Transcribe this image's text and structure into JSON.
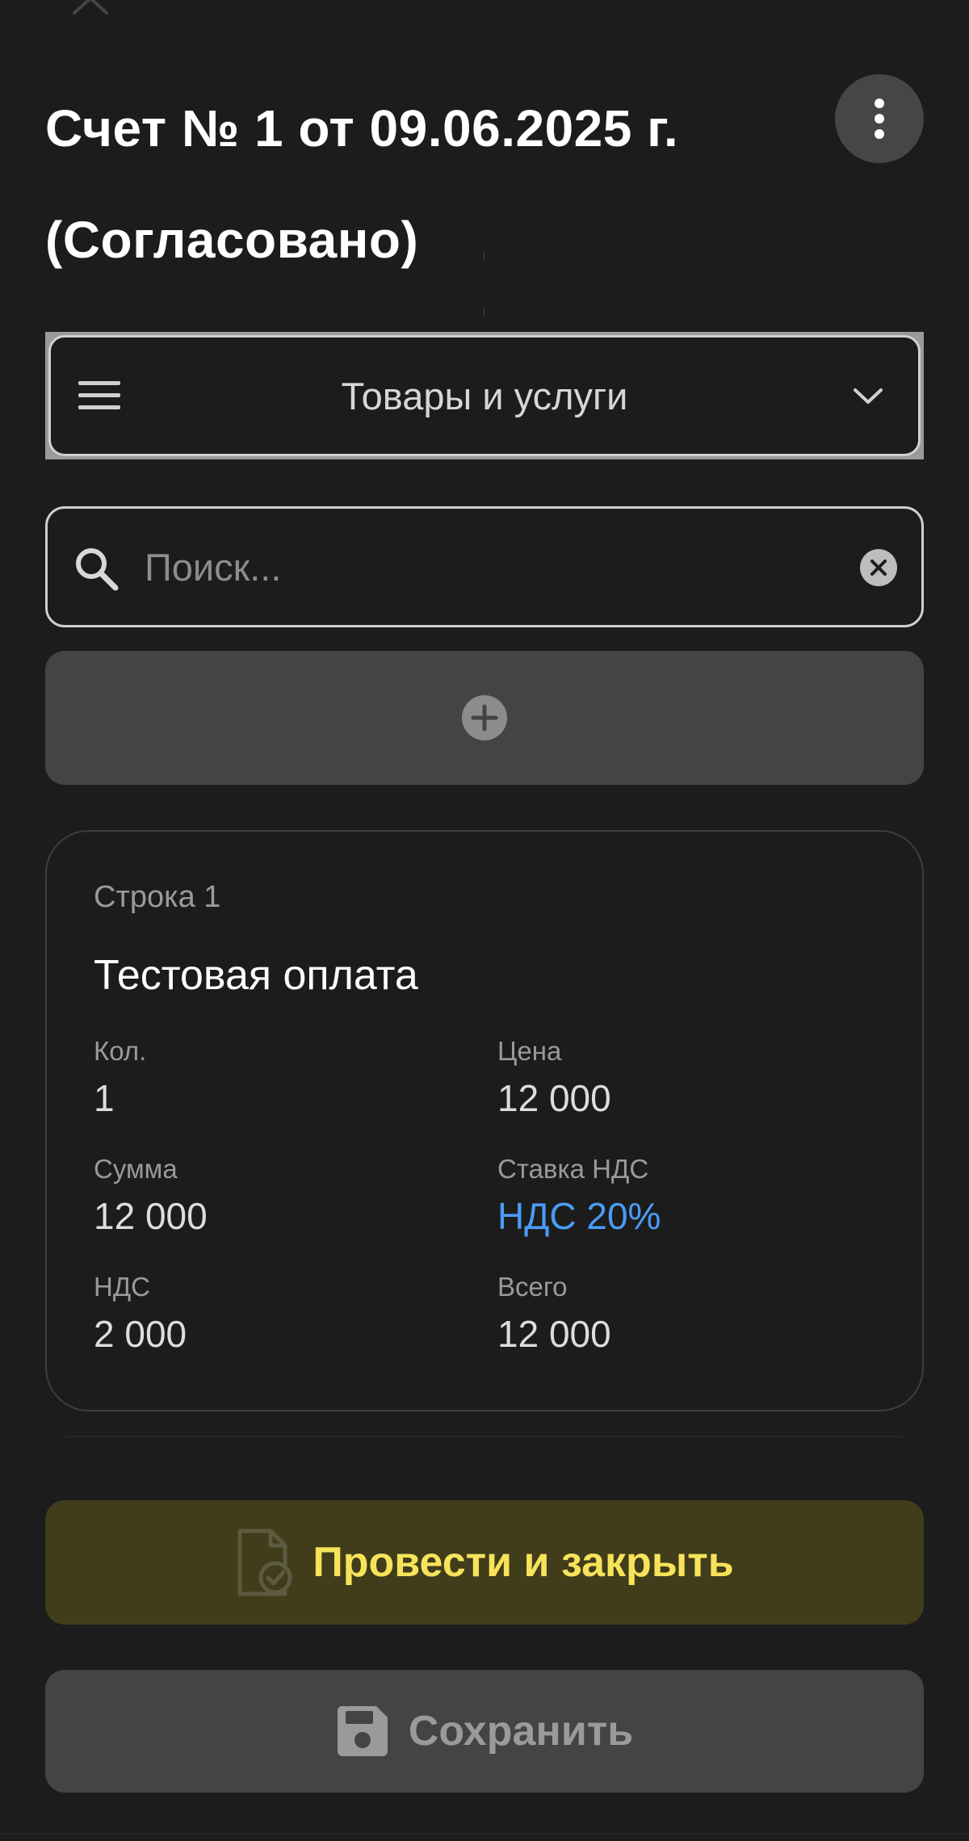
{
  "header": {
    "title_line1": "Счет № 1 от 09.06.2025 г.",
    "title_line2": "(Согласовано)",
    "menu_icon": "more-vertical-icon"
  },
  "section_select": {
    "label": "Товары и услуги",
    "left_icon": "hamburger-icon",
    "right_icon": "chevron-down-icon"
  },
  "search": {
    "placeholder": "Поиск...",
    "value": "",
    "icon": "search-icon",
    "clear_icon": "clear-circle-icon"
  },
  "add_row": {
    "icon": "plus-circle-icon"
  },
  "rows": [
    {
      "number_label": "Строка 1",
      "name": "Тестовая оплата",
      "quantity_label": "Кол.",
      "quantity": "1",
      "price_label": "Цена",
      "price": "12 000",
      "amount_label": "Сумма",
      "amount": "12 000",
      "vat_rate_label": "Ставка НДС",
      "vat_rate": "НДС 20%",
      "vat_label": "НДС",
      "vat": "2 000",
      "total_label": "Всего",
      "total": "12 000"
    }
  ],
  "actions": {
    "post_and_close": "Провести и закрыть",
    "post_icon": "document-check-icon",
    "save": "Сохранить",
    "save_icon": "floppy-disk-icon"
  },
  "colors": {
    "background": "#1c1c1d",
    "accent_yellow": "#f7e35a",
    "link_blue": "#4a9cf5"
  }
}
